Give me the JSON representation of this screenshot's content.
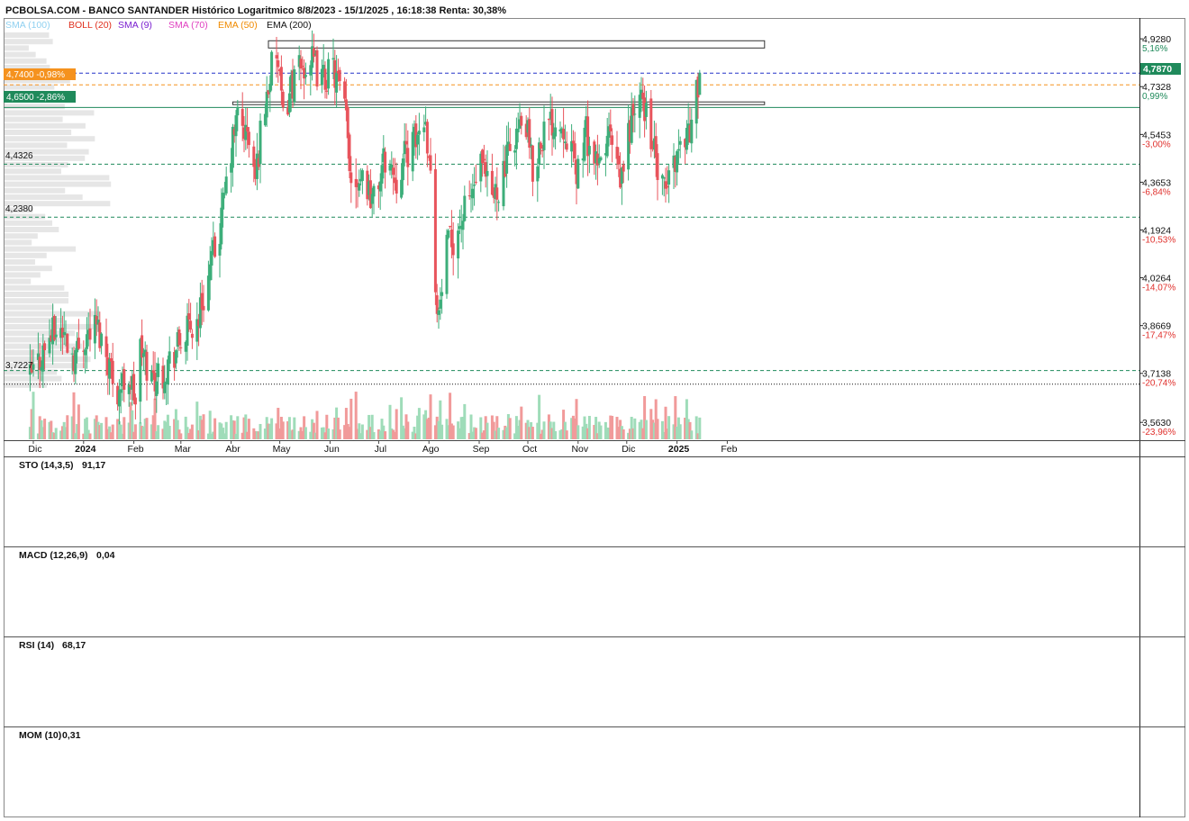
{
  "header": {
    "title": "PCBOLSA.COM - BANCO SANTANDER Histórico Logaritmico 8/8/2023 - 15/1/2025 , 16:18:38 Renta: 30,38%",
    "indicators": [
      {
        "label": "SMA (100)",
        "color": "#8fd0f0"
      },
      {
        "label": "BOLL (20)",
        "color": "#e0301e"
      },
      {
        "label": "SMA (9)",
        "color": "#7a1fd0"
      },
      {
        "label": "SMA (70)",
        "color": "#e040c0"
      },
      {
        "label": "EMA (50)",
        "color": "#f08a00"
      },
      {
        "label": "EMA (200)",
        "color": "#111111"
      }
    ]
  },
  "colors": {
    "up": "#3dae7a",
    "down": "#e8545c",
    "vol_up": "#9fdcb9",
    "vol_down": "#f19a9a",
    "accent_orange": "#f5921e",
    "accent_green": "#1f8a5b",
    "blue_dash": "#2434c8"
  },
  "price_scale": {
    "ticks": [
      {
        "value": "4,9280",
        "pct": "5,16%",
        "pct_color": "#1f8a5b"
      },
      {
        "value": "4,7328",
        "pct": "0,99%",
        "pct_color": "#1f8a5b"
      },
      {
        "value": "4,5453",
        "pct": "-3,00%",
        "pct_color": "#e0302c"
      },
      {
        "value": "4,3653",
        "pct": "-6,84%",
        "pct_color": "#e0302c"
      },
      {
        "value": "4,1924",
        "pct": "-10,53%",
        "pct_color": "#e0302c"
      },
      {
        "value": "4,0264",
        "pct": "-14,07%",
        "pct_color": "#e0302c"
      },
      {
        "value": "3,8669",
        "pct": "-17,47%",
        "pct_color": "#e0302c"
      },
      {
        "value": "3,7138",
        "pct": "-20,74%",
        "pct_color": "#e0302c"
      },
      {
        "value": "3,5630",
        "pct": "-23,96%",
        "pct_color": "#e0302c"
      }
    ],
    "last_price_tag": "4,7870"
  },
  "left_tags": {
    "orange": "4,7400 -0,98%",
    "green": "4,6500 -2,86%"
  },
  "level_labels": [
    "4,4326",
    "4,2380",
    "3,7227"
  ],
  "x_axis": {
    "labels": [
      "Dic",
      "2024",
      "Feb",
      "Mar",
      "Abr",
      "May",
      "Jun",
      "Jul",
      "Ago",
      "Sep",
      "Oct",
      "Nov",
      "Dic",
      "2025",
      "Feb"
    ],
    "bold": [
      false,
      true,
      false,
      false,
      false,
      false,
      false,
      false,
      false,
      false,
      false,
      false,
      false,
      true,
      false
    ]
  },
  "panels": [
    {
      "label": "STO (14,3,5)",
      "value": "91,17"
    },
    {
      "label": "MACD (12,26,9)",
      "value": "0,04"
    },
    {
      "label": "RSI (14)",
      "value": "68,17"
    },
    {
      "label": "MOM (10)",
      "value": "0,31"
    }
  ],
  "chart_data": {
    "type": "candlestick",
    "scale": "log",
    "ylim": [
      3.55,
      4.97
    ],
    "close_anchors": [
      {
        "date": "2023-11-29",
        "close": 3.7
      },
      {
        "date": "2023-12-05",
        "close": 3.76
      },
      {
        "date": "2023-12-11",
        "close": 3.83
      },
      {
        "date": "2023-12-18",
        "close": 3.86
      },
      {
        "date": "2023-12-26",
        "close": 3.77
      },
      {
        "date": "2024-01-03",
        "close": 3.84
      },
      {
        "date": "2024-01-09",
        "close": 3.87
      },
      {
        "date": "2024-01-15",
        "close": 3.78
      },
      {
        "date": "2024-01-22",
        "close": 3.66
      },
      {
        "date": "2024-01-29",
        "close": 3.71
      },
      {
        "date": "2024-02-02",
        "close": 3.63
      },
      {
        "date": "2024-02-05",
        "close": 3.79
      },
      {
        "date": "2024-02-12",
        "close": 3.7
      },
      {
        "date": "2024-02-19",
        "close": 3.72
      },
      {
        "date": "2024-02-26",
        "close": 3.78
      },
      {
        "date": "2024-03-04",
        "close": 3.84
      },
      {
        "date": "2024-03-11",
        "close": 3.88
      },
      {
        "date": "2024-03-18",
        "close": 4.03
      },
      {
        "date": "2024-03-25",
        "close": 4.19
      },
      {
        "date": "2024-04-02",
        "close": 4.52
      },
      {
        "date": "2024-04-05",
        "close": 4.62
      },
      {
        "date": "2024-04-12",
        "close": 4.52
      },
      {
        "date": "2024-04-16",
        "close": 4.37
      },
      {
        "date": "2024-04-19",
        "close": 4.55
      },
      {
        "date": "2024-04-25",
        "close": 4.78
      },
      {
        "date": "2024-04-29",
        "close": 4.87
      },
      {
        "date": "2024-05-03",
        "close": 4.6
      },
      {
        "date": "2024-05-08",
        "close": 4.74
      },
      {
        "date": "2024-05-14",
        "close": 4.8
      },
      {
        "date": "2024-05-20",
        "close": 4.84
      },
      {
        "date": "2024-05-27",
        "close": 4.76
      },
      {
        "date": "2024-06-03",
        "close": 4.8
      },
      {
        "date": "2024-06-07",
        "close": 4.72
      },
      {
        "date": "2024-06-11",
        "close": 4.6
      },
      {
        "date": "2024-06-14",
        "close": 4.38
      },
      {
        "date": "2024-06-21",
        "close": 4.4
      },
      {
        "date": "2024-06-28",
        "close": 4.3
      },
      {
        "date": "2024-07-05",
        "close": 4.46
      },
      {
        "date": "2024-07-12",
        "close": 4.38
      },
      {
        "date": "2024-07-18",
        "close": 4.48
      },
      {
        "date": "2024-07-24",
        "close": 4.52
      },
      {
        "date": "2024-07-29",
        "close": 4.62
      },
      {
        "date": "2024-08-01",
        "close": 4.5
      },
      {
        "date": "2024-08-05",
        "close": 4.02
      },
      {
        "date": "2024-08-07",
        "close": 3.9
      },
      {
        "date": "2024-08-12",
        "close": 4.12
      },
      {
        "date": "2024-08-19",
        "close": 4.2
      },
      {
        "date": "2024-08-26",
        "close": 4.3
      },
      {
        "date": "2024-09-02",
        "close": 4.42
      },
      {
        "date": "2024-09-09",
        "close": 4.3
      },
      {
        "date": "2024-09-16",
        "close": 4.4
      },
      {
        "date": "2024-09-23",
        "close": 4.55
      },
      {
        "date": "2024-09-30",
        "close": 4.58
      },
      {
        "date": "2024-10-04",
        "close": 4.4
      },
      {
        "date": "2024-10-10",
        "close": 4.55
      },
      {
        "date": "2024-10-17",
        "close": 4.6
      },
      {
        "date": "2024-10-24",
        "close": 4.58
      },
      {
        "date": "2024-10-31",
        "close": 4.4
      },
      {
        "date": "2024-11-06",
        "close": 4.55
      },
      {
        "date": "2024-11-13",
        "close": 4.4
      },
      {
        "date": "2024-11-20",
        "close": 4.55
      },
      {
        "date": "2024-11-27",
        "close": 4.35
      },
      {
        "date": "2024-12-04",
        "close": 4.62
      },
      {
        "date": "2024-12-11",
        "close": 4.68
      },
      {
        "date": "2024-12-16",
        "close": 4.55
      },
      {
        "date": "2024-12-20",
        "close": 4.4
      },
      {
        "date": "2024-12-24",
        "close": 4.32
      },
      {
        "date": "2024-12-31",
        "close": 4.46
      },
      {
        "date": "2025-01-06",
        "close": 4.55
      },
      {
        "date": "2025-01-10",
        "close": 4.58
      },
      {
        "date": "2025-01-15",
        "close": 4.787
      }
    ],
    "horizontal_levels": [
      {
        "value": 4.787,
        "style": "dashed",
        "color": "#2434c8"
      },
      {
        "value": 4.74,
        "style": "dashed",
        "color": "#f5921e"
      },
      {
        "value": 4.65,
        "style": "solid",
        "color": "#1f8a5b"
      },
      {
        "value": 4.4326,
        "style": "dashed",
        "color": "#1f8a5b"
      },
      {
        "value": 4.238,
        "style": "dashed",
        "color": "#1f8a5b"
      },
      {
        "value": 3.7227,
        "style": "dashed",
        "color": "#1f8a5b"
      },
      {
        "value": 3.68,
        "style": "dotted",
        "color": "#111111"
      }
    ],
    "resistance_boxes": [
      {
        "from": "2024-04-24",
        "to": "2025-02-24",
        "low": 4.89,
        "high": 4.92
      },
      {
        "from": "2024-04-02",
        "to": "2025-02-24",
        "low": 4.663,
        "high": 4.672
      }
    ]
  }
}
